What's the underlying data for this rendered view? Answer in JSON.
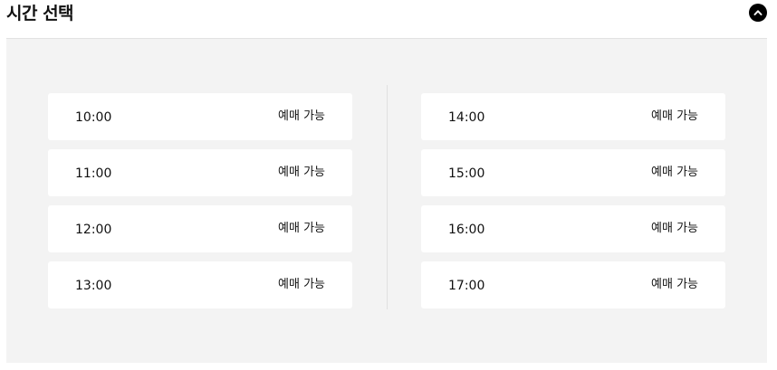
{
  "header": {
    "title": "시간 선택",
    "collapse_icon": "chevron-up-icon"
  },
  "slots_left": [
    {
      "time": "10:00",
      "status": "예매 가능"
    },
    {
      "time": "11:00",
      "status": "예매 가능"
    },
    {
      "time": "12:00",
      "status": "예매 가능"
    },
    {
      "time": "13:00",
      "status": "예매 가능"
    }
  ],
  "slots_right": [
    {
      "time": "14:00",
      "status": "예매 가능"
    },
    {
      "time": "15:00",
      "status": "예매 가능"
    },
    {
      "time": "16:00",
      "status": "예매 가능"
    },
    {
      "time": "17:00",
      "status": "예매 가능"
    }
  ]
}
